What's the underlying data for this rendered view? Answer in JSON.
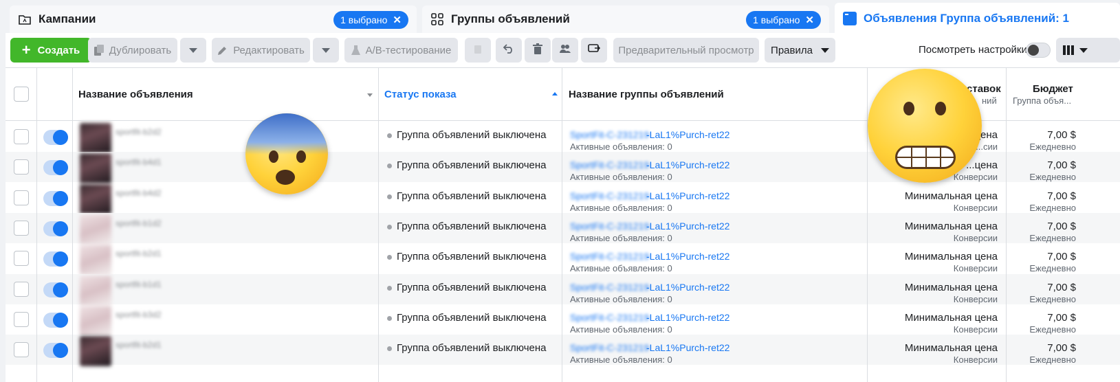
{
  "tabs": [
    {
      "label": "Кампании",
      "badge": "1 выбрано",
      "icon": "folder-icon"
    },
    {
      "label": "Группы объявлений",
      "badge": "1 выбрано",
      "icon": "adsets-grid-icon"
    },
    {
      "label": "Объявления Группа объявлений: 1",
      "icon": "ad-window-icon"
    }
  ],
  "toolbar": {
    "create": "Создать",
    "duplicate": "Дублировать",
    "edit": "Редактировать",
    "ab_test": "A/B-тестирование",
    "preview": "Предварительный просмотр",
    "rules": "Правила",
    "view_settings": "Посмотреть настройки"
  },
  "columns": {
    "ad_name": "Название объявления",
    "delivery": "Статус показа",
    "adset_name": "Название группы объявлений",
    "bid_strategy": "ставок",
    "bid_strategy_sub": "ний",
    "budget": "Бюджет",
    "budget_sub": "Группа объя..."
  },
  "rows": [
    {
      "ad_name": "sportfit-b2d2",
      "status": "Группа объявлений выключена",
      "adset_blur": "SportFit-C-231219",
      "adset_suffix": "-LaL1%Purch-ret22",
      "adset_sub": "Активные объявления: 0",
      "bid": "...цена",
      "bid_sub": "...сии",
      "budget": "7,00 $",
      "budget_sub": "Ежедневно",
      "thumb": "dark"
    },
    {
      "ad_name": "sportfit-b4d1",
      "status": "Группа объявлений выключена",
      "adset_blur": "SportFit-C-231219",
      "adset_suffix": "-LaL1%Purch-ret22",
      "adset_sub": "Активные объявления: 0",
      "bid": "...цена",
      "bid_sub": "Конверсии",
      "budget": "7,00 $",
      "budget_sub": "Ежедневно",
      "thumb": "dark"
    },
    {
      "ad_name": "sportfit-b4d2",
      "status": "Группа объявлений выключена",
      "adset_blur": "SportFit-C-231219",
      "adset_suffix": "-LaL1%Purch-ret22",
      "adset_sub": "Активные объявления: 0",
      "bid": "Минимальная цена",
      "bid_sub": "Конверсии",
      "budget": "7,00 $",
      "budget_sub": "Ежедневно",
      "thumb": "dark"
    },
    {
      "ad_name": "sportfit-b1d2",
      "status": "Группа объявлений выключена",
      "adset_blur": "SportFit-C-231219",
      "adset_suffix": "-LaL1%Purch-ret22",
      "adset_sub": "Активные объявления: 0",
      "bid": "Минимальная цена",
      "bid_sub": "Конверсии",
      "budget": "7,00 $",
      "budget_sub": "Ежедневно",
      "thumb": "light"
    },
    {
      "ad_name": "sportfit-b2d1",
      "status": "Группа объявлений выключена",
      "adset_blur": "SportFit-C-231219",
      "adset_suffix": "-LaL1%Purch-ret22",
      "adset_sub": "Активные объявления: 0",
      "bid": "Минимальная цена",
      "bid_sub": "Конверсии",
      "budget": "7,00 $",
      "budget_sub": "Ежедневно",
      "thumb": "light"
    },
    {
      "ad_name": "sportfit-b1d1",
      "status": "Группа объявлений выключена",
      "adset_blur": "SportFit-C-231219",
      "adset_suffix": "-LaL1%Purch-ret22",
      "adset_sub": "Активные объявления: 0",
      "bid": "Минимальная цена",
      "bid_sub": "Конверсии",
      "budget": "7,00 $",
      "budget_sub": "Ежедневно",
      "thumb": "light"
    },
    {
      "ad_name": "sportfit-b3d2",
      "status": "Группа объявлений выключена",
      "adset_blur": "SportFit-C-231219",
      "adset_suffix": "-LaL1%Purch-ret22",
      "adset_sub": "Активные объявления: 0",
      "bid": "Минимальная цена",
      "bid_sub": "Конверсии",
      "budget": "7,00 $",
      "budget_sub": "Ежедневно",
      "thumb": "light"
    },
    {
      "ad_name": "sportfit-b2d1",
      "status": "Группа объявлений выключена",
      "adset_blur": "SportFit-C-231219",
      "adset_suffix": "-LaL1%Purch-ret22",
      "adset_sub": "Активные объявления: 0",
      "bid": "Минимальная цена",
      "bid_sub": "Конверсии",
      "budget": "7,00 $",
      "budget_sub": "Ежедневно",
      "thumb": "dark"
    }
  ],
  "colors": {
    "accent": "#1877f2",
    "create": "#42b72a",
    "status_dot": "#a0a3a8"
  }
}
